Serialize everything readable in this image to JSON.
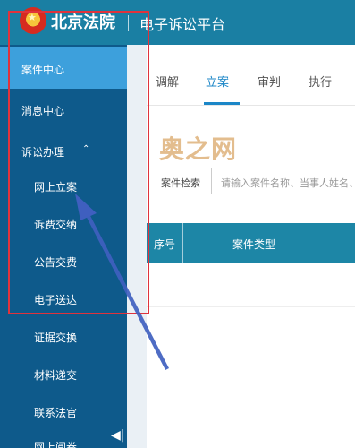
{
  "header": {
    "brand": "北京法院",
    "platform": "电子诉讼平台"
  },
  "sidebar": {
    "items": [
      {
        "label": "案件中心"
      },
      {
        "label": "消息中心"
      },
      {
        "label": "诉讼办理"
      },
      {
        "label": "网上立案"
      },
      {
        "label": "诉费交纳"
      },
      {
        "label": "公告交费"
      },
      {
        "label": "电子送达"
      },
      {
        "label": "证据交换"
      },
      {
        "label": "材料递交"
      },
      {
        "label": "联系法官"
      },
      {
        "label": "网上阅卷"
      }
    ],
    "caret": "⌃",
    "collapse": "◀|"
  },
  "tabs": [
    {
      "label": "调解"
    },
    {
      "label": "立案"
    },
    {
      "label": "审判"
    },
    {
      "label": "执行"
    }
  ],
  "search": {
    "label": "案件检索",
    "placeholder": "请输入案件名称、当事人姓名、"
  },
  "table": {
    "headers": [
      "序号",
      "案件类型"
    ]
  },
  "watermark": "奥之网",
  "colors": {
    "header": "#1a7fa3",
    "sidebar": "#0e5a8b",
    "active_item": "#3da0dc",
    "active_tab": "#1b86c7",
    "table_header": "#1d86a6",
    "highlight": "#e0333c",
    "arrow": "#3f5fbf"
  }
}
